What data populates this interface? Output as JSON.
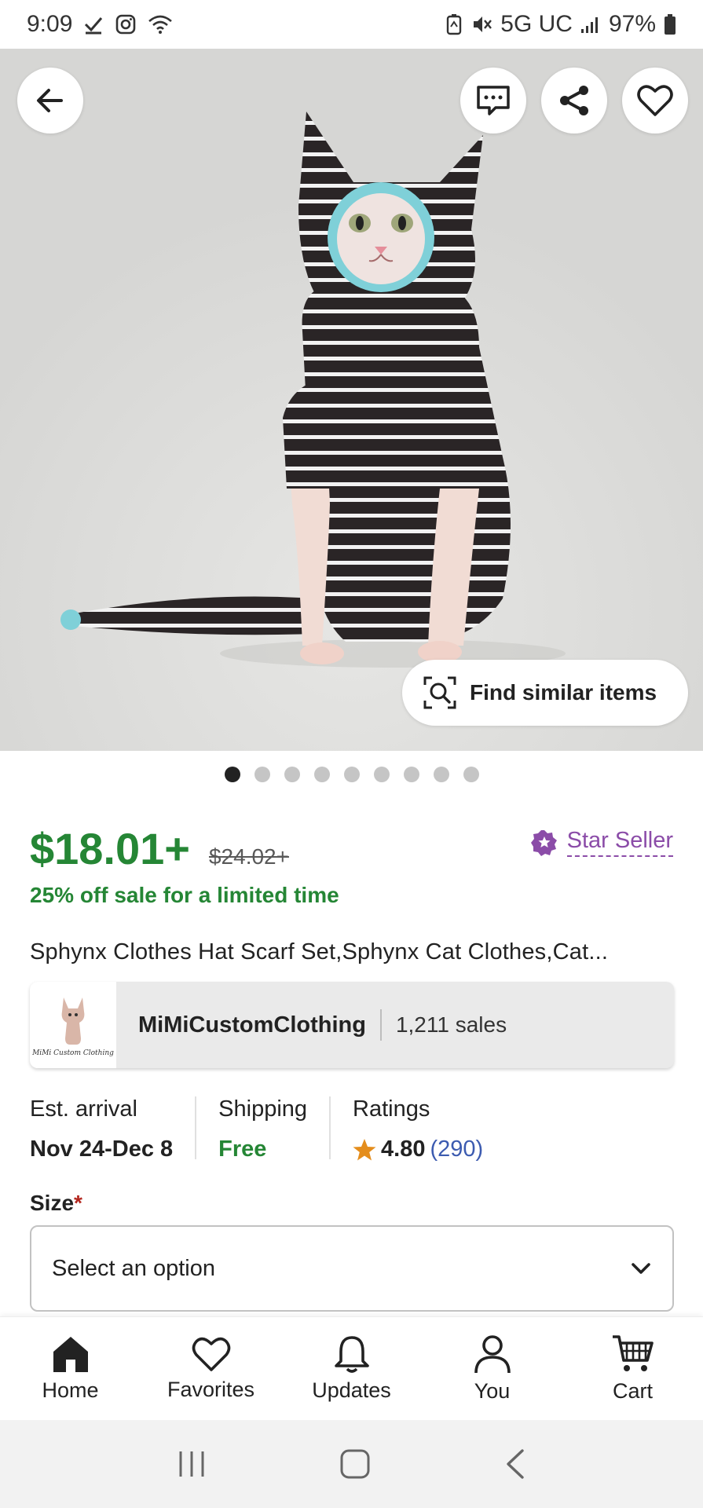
{
  "status_bar": {
    "time": "9:09",
    "network": "5G UC",
    "battery": "97%",
    "icons_left": [
      "check-icon",
      "instagram-icon",
      "wifi-icon"
    ],
    "icons_right": [
      "battery-saver-icon",
      "mute-icon",
      "signal-icon",
      "battery-icon"
    ]
  },
  "hero": {
    "image_subject": "sphynx-cat-striped-outfit-photo",
    "find_similar_label": "Find similar items",
    "page_dots_total": 9,
    "page_dot_active": 1
  },
  "product": {
    "price": "$18.01+",
    "original_price": "$24.02+",
    "sale_text": "25% off sale for a limited time",
    "star_seller_label": "Star Seller",
    "title": "Sphynx Clothes Hat Scarf Set,Sphynx Cat Clothes,Cat..."
  },
  "shop": {
    "name": "MiMiCustomClothing",
    "sales": "1,211 sales",
    "logo_text": "MiMi Custom Clothing"
  },
  "info": {
    "arrival_label": "Est. arrival",
    "arrival_value": "Nov 24-Dec 8",
    "shipping_label": "Shipping",
    "shipping_value": "Free",
    "ratings_label": "Ratings",
    "rating_value": "4.80",
    "rating_count": "(290)"
  },
  "size": {
    "label": "Size",
    "required_mark": "*",
    "select_value": "Select an option"
  },
  "nav": [
    {
      "label": "Home",
      "icon": "home-icon"
    },
    {
      "label": "Favorites",
      "icon": "heart-icon"
    },
    {
      "label": "Updates",
      "icon": "bell-icon"
    },
    {
      "label": "You",
      "icon": "person-icon"
    },
    {
      "label": "Cart",
      "icon": "cart-icon"
    }
  ],
  "colors": {
    "price_green": "#258635",
    "star_seller_purple": "#8b4ca8",
    "rating_star": "#e48d1c",
    "rating_count_blue": "#3c5bb0"
  }
}
